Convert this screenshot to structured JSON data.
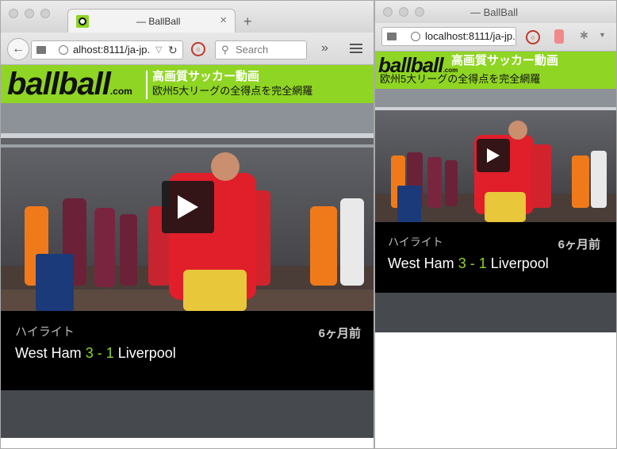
{
  "left_window": {
    "tab": {
      "title": "— BallBall",
      "close": "×",
      "new_tab": "+"
    },
    "url": "alhost:8111/ja-jp.",
    "search_placeholder": "Search",
    "overflow": "»"
  },
  "right_window": {
    "title": "— BallBall",
    "url": "localhost:8111/ja-jp."
  },
  "site": {
    "logo": "ballball",
    "logo_suffix": ".com",
    "title": "高画質サッカー動画",
    "subtitle": "欧州5大リーグの全得点を完全網羅"
  },
  "card": {
    "category": "ハイライト",
    "age": "6ヶ月前",
    "home": "West Ham",
    "score": "3 - 1",
    "away": "Liverpool"
  },
  "colors": {
    "brand_green": "#8fd523",
    "card_bg": "#000000",
    "footer_grey": "#46494d"
  }
}
